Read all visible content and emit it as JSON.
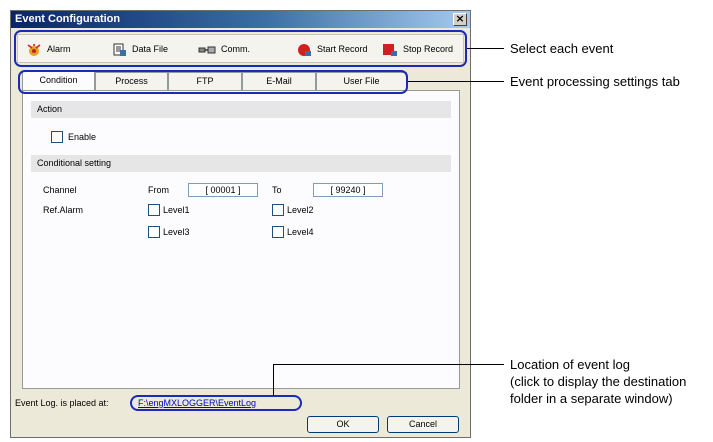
{
  "window": {
    "title": "Event Configuration",
    "close_glyph": "×"
  },
  "toolbar": {
    "items": [
      {
        "label": "Alarm",
        "icon": "alarm-icon"
      },
      {
        "label": "Data File",
        "icon": "data-file-icon"
      },
      {
        "label": "Comm.",
        "icon": "comm-icon"
      },
      {
        "label": "Start Record",
        "icon": "start-record-icon"
      },
      {
        "label": "Stop Record",
        "icon": "stop-record-icon"
      }
    ]
  },
  "tabs": [
    {
      "label": "Condition",
      "active": true
    },
    {
      "label": "Process"
    },
    {
      "label": "FTP"
    },
    {
      "label": "E-Mail"
    },
    {
      "label": "User File"
    }
  ],
  "action": {
    "header": "Action",
    "enable_label": "Enable",
    "enabled": false
  },
  "conditional": {
    "header": "Conditional setting",
    "channel_label": "Channel",
    "from_label": "From",
    "from_value": "[ 00001 ]",
    "to_label": "To",
    "to_value": "[ 99240 ]",
    "ref_alarm_label": "Ref.Alarm",
    "levels": [
      "Level1",
      "Level2",
      "Level3",
      "Level4"
    ]
  },
  "event_log": {
    "label": "Event Log. is  placed at:",
    "path": "F:\\engMXLOGGER\\EventLog"
  },
  "buttons": {
    "ok": "OK",
    "cancel": "Cancel"
  },
  "callouts": {
    "select_event": "Select each event",
    "tab_settings": "Event processing settings tab",
    "log_line1": "Location of event log",
    "log_line2": "(click to display the destination",
    "log_line3": "folder in a separate window)"
  },
  "colors": {
    "highlight": "#1a2bb5",
    "title_bar": "#0a246a",
    "link": "#0000cc"
  }
}
